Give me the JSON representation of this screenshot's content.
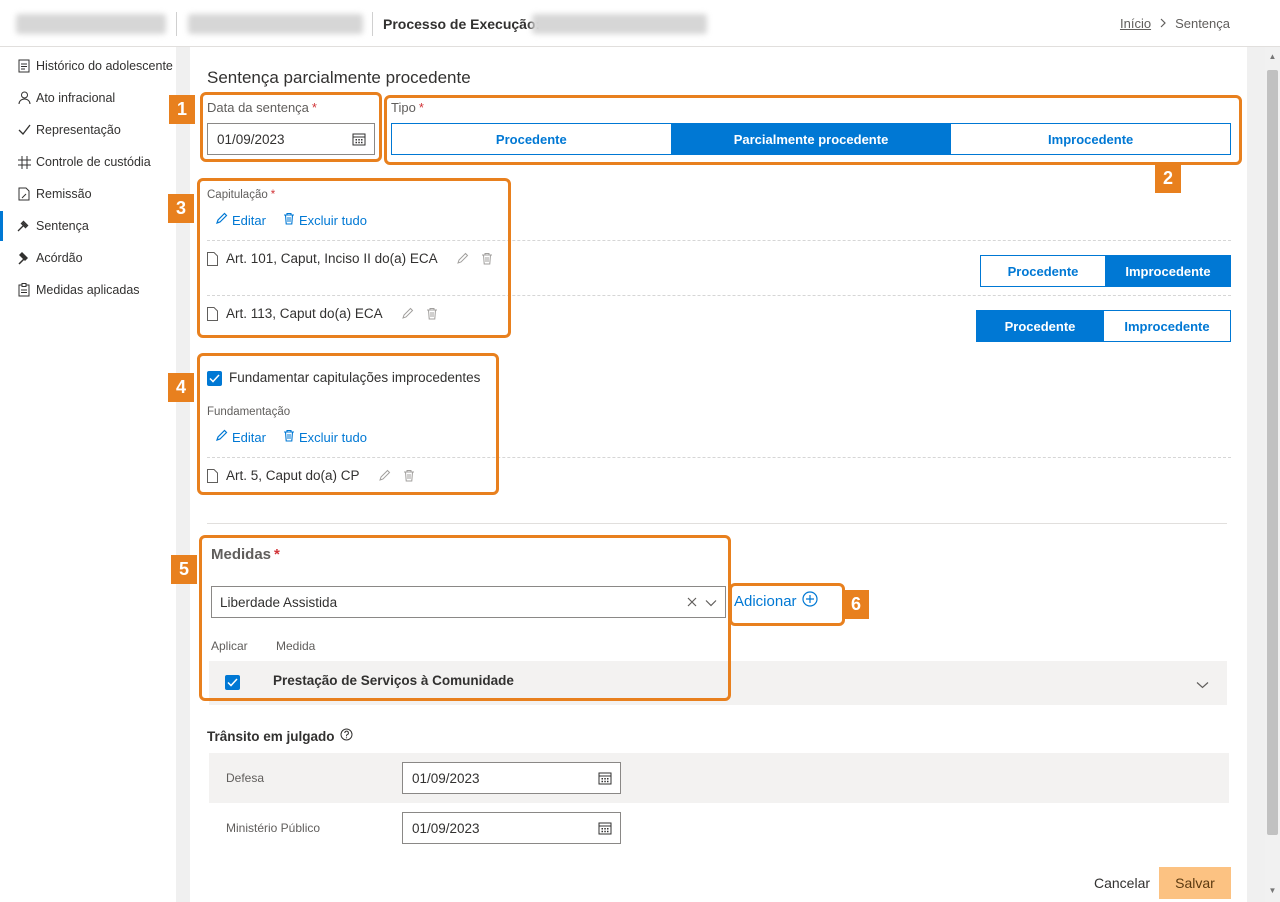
{
  "header": {
    "process_label": "Processo de Execução:",
    "breadcrumb_home": "Início",
    "breadcrumb_current": "Sentença"
  },
  "sidebar": {
    "items": [
      {
        "label": "Histórico do adolescente",
        "icon": "document-icon"
      },
      {
        "label": "Ato infracional",
        "icon": "person-icon"
      },
      {
        "label": "Representação",
        "icon": "check-icon"
      },
      {
        "label": "Controle de custódia",
        "icon": "grid-icon"
      },
      {
        "label": "Remissão",
        "icon": "doc-edit-icon"
      },
      {
        "label": "Sentença",
        "icon": "gavel-icon"
      },
      {
        "label": "Acórdão",
        "icon": "hammer-icon"
      },
      {
        "label": "Medidas aplicadas",
        "icon": "clipboard-icon"
      }
    ],
    "active": "Sentença"
  },
  "form": {
    "title": "Sentença parcialmente procedente",
    "data_label": "Data da sentença",
    "data_value": "01/09/2023",
    "tipo_label": "Tipo",
    "tipo_options": [
      "Procedente",
      "Parcialmente procedente",
      "Improcedente"
    ],
    "tipo_selected": "Parcialmente procedente",
    "capitulacao_label": "Capitulação",
    "editar": "Editar",
    "excluir_tudo": "Excluir tudo",
    "capitulacoes": [
      {
        "text": "Art. 101, Caput, Inciso II do(a) ECA",
        "options": [
          "Procedente",
          "Improcedente"
        ],
        "selected": "Improcedente"
      },
      {
        "text": "Art. 113, Caput do(a) ECA",
        "options": [
          "Procedente",
          "Improcedente"
        ],
        "selected": "Procedente"
      }
    ],
    "fundamentar_label": "Fundamentar capitulações improcedentes",
    "fundamentar_checked": true,
    "fundamentacao_label": "Fundamentação",
    "fundamentacoes": [
      "Art. 5, Caput do(a) CP"
    ],
    "medidas_label": "Medidas",
    "medida_select_value": "Liberdade Assistida",
    "adicionar": "Adicionar",
    "col_aplicar": "Aplicar",
    "col_medida": "Medida",
    "medidas": [
      {
        "name": "Prestação de Serviços à Comunidade",
        "checked": true
      }
    ],
    "transito_label": "Trânsito em julgado",
    "defesa_label": "Defesa",
    "defesa_value": "01/09/2023",
    "mp_label": "Ministério Público",
    "mp_value": "01/09/2023",
    "cancelar": "Cancelar",
    "salvar": "Salvar"
  },
  "callouts": [
    "1",
    "2",
    "3",
    "4",
    "5",
    "6"
  ],
  "colors": {
    "accent": "#0078d4",
    "callout": "#e8801e",
    "save": "#fcc282",
    "required": "#d13438"
  }
}
